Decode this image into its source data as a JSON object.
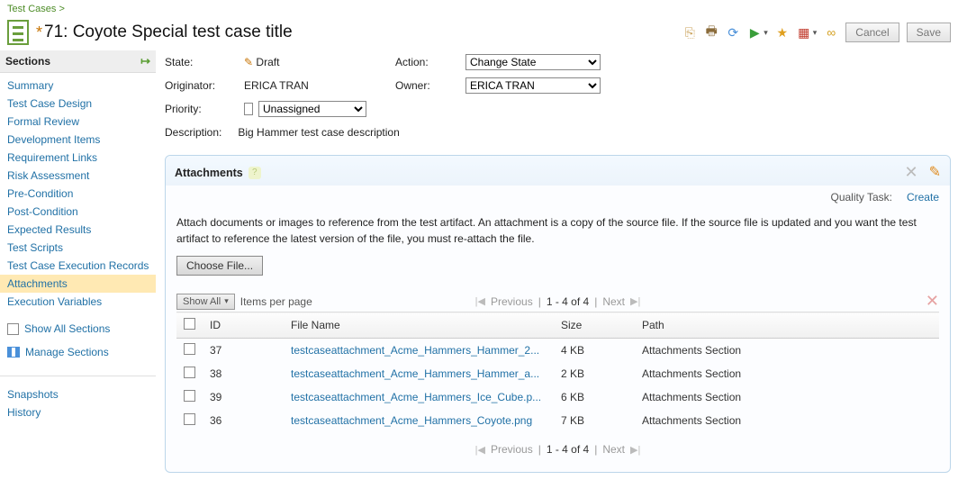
{
  "breadcrumb": {
    "label": "Test Cases",
    "sep": ">"
  },
  "dirty_marker": "*",
  "title": "71: Coyote Special test case title",
  "buttons": {
    "cancel": "Cancel",
    "save": "Save"
  },
  "sidebar": {
    "heading": "Sections",
    "items": [
      "Summary",
      "Test Case Design",
      "Formal Review",
      "Development Items",
      "Requirement Links",
      "Risk Assessment",
      "Pre-Condition",
      "Post-Condition",
      "Expected Results",
      "Test Scripts",
      "Test Case Execution Records",
      "Attachments",
      "Execution Variables"
    ],
    "selected_index": 11,
    "show_all": "Show All Sections",
    "manage": "Manage Sections",
    "group2": [
      "Snapshots",
      "History"
    ]
  },
  "fields": {
    "state_label": "State:",
    "state_value": "Draft",
    "action_label": "Action:",
    "action_value": "Change State",
    "originator_label": "Originator:",
    "originator_value": "ERICA TRAN",
    "owner_label": "Owner:",
    "owner_value": "ERICA TRAN",
    "priority_label": "Priority:",
    "priority_value": "Unassigned",
    "description_label": "Description:",
    "description_value": "Big Hammer test case description"
  },
  "panel": {
    "title": "Attachments",
    "quality_task_label": "Quality Task:",
    "create": "Create",
    "desc": "Attach documents or images to reference from the test artifact. An attachment is a copy of the source file. If the source file is updated and you want the test artifact to reference the latest version of the file, you must re-attach the file.",
    "choose_file": "Choose File...",
    "show_all": "Show All",
    "items_per_page": "Items per page",
    "prev": "Previous",
    "next": "Next",
    "count": "1 - 4 of 4",
    "columns": {
      "id": "ID",
      "file": "File Name",
      "size": "Size",
      "path": "Path"
    },
    "rows": [
      {
        "id": "37",
        "file": "testcaseattachment_Acme_Hammers_Hammer_2...",
        "size": "4 KB",
        "path": "Attachments Section"
      },
      {
        "id": "38",
        "file": "testcaseattachment_Acme_Hammers_Hammer_a...",
        "size": "2 KB",
        "path": "Attachments Section"
      },
      {
        "id": "39",
        "file": "testcaseattachment_Acme_Hammers_Ice_Cube.p...",
        "size": "6 KB",
        "path": "Attachments Section"
      },
      {
        "id": "36",
        "file": "testcaseattachment_Acme_Hammers_Coyote.png",
        "size": "7 KB",
        "path": "Attachments Section"
      }
    ]
  }
}
